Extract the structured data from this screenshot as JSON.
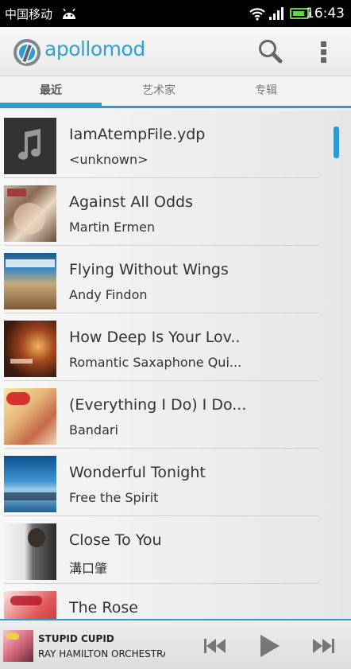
{
  "status_bar": {
    "carrier": "中国移动",
    "time": "16:43"
  },
  "app": {
    "logo_text": "apollomod",
    "accent_color": "#2e9bd0"
  },
  "tabs": [
    {
      "label": "最近",
      "active": true
    },
    {
      "label": "艺术家",
      "active": false
    },
    {
      "label": "专辑",
      "active": false
    }
  ],
  "songs": [
    {
      "title": "IamAtempFile.ydp",
      "artist": "<unknown>",
      "art": "music-note-placeholder"
    },
    {
      "title": "Against All Odds",
      "artist": "Martin Ermen",
      "art": "album-cover"
    },
    {
      "title": "Flying Without Wings",
      "artist": "Andy Findon",
      "art": "album-cover"
    },
    {
      "title": "How Deep Is Your Lov..",
      "artist": "Romantic Saxaphone Qui...",
      "art": "album-cover"
    },
    {
      "title": "(Everything I Do) I Do...",
      "artist": "Bandari",
      "art": "album-cover"
    },
    {
      "title": "Wonderful Tonight",
      "artist": "Free the Spirit",
      "art": "album-cover"
    },
    {
      "title": "Close To You",
      "artist": "溝口肇",
      "art": "album-cover"
    },
    {
      "title": "The Rose",
      "artist": "",
      "art": "album-cover"
    }
  ],
  "now_playing": {
    "title": "STUPID CUPID",
    "artist": "RAY HAMILTON ORCHESTRA"
  },
  "icons": {
    "search": "search-icon",
    "overflow": "overflow-menu-icon",
    "previous": "skip-previous-icon",
    "play": "play-icon",
    "next": "skip-next-icon"
  }
}
